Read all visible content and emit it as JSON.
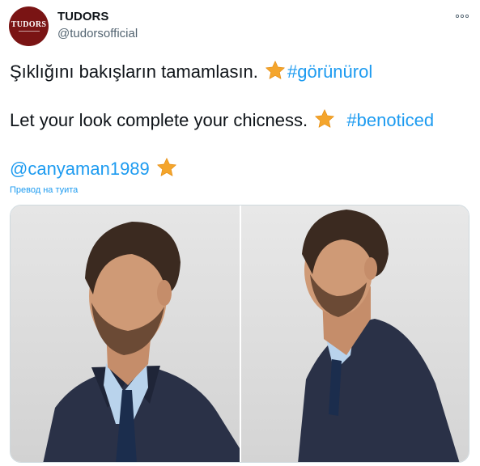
{
  "account": {
    "display_name": "TUDORS",
    "handle": "@tudorsofficial",
    "avatar_text": "TUDORS"
  },
  "tweet": {
    "line1_text": "Şıklığını bakışların tamamlasın. ",
    "line1_hashtag": "#görünürol",
    "line2_text": "Let your look complete your chicness. ",
    "line2_hashtag": "#benoticed",
    "line3_mention": "@canyaman1989",
    "translate_label": "Превод на туита"
  },
  "icons": {
    "more": "more-horizontal-icon",
    "star": "star-emoji-icon"
  },
  "media": {
    "photo_count": 2
  },
  "colors": {
    "link": "#1d9bf0",
    "text": "#0f1419",
    "secondary": "#536471",
    "avatar_bg": "#7a1414",
    "star": "#f4a52c"
  }
}
